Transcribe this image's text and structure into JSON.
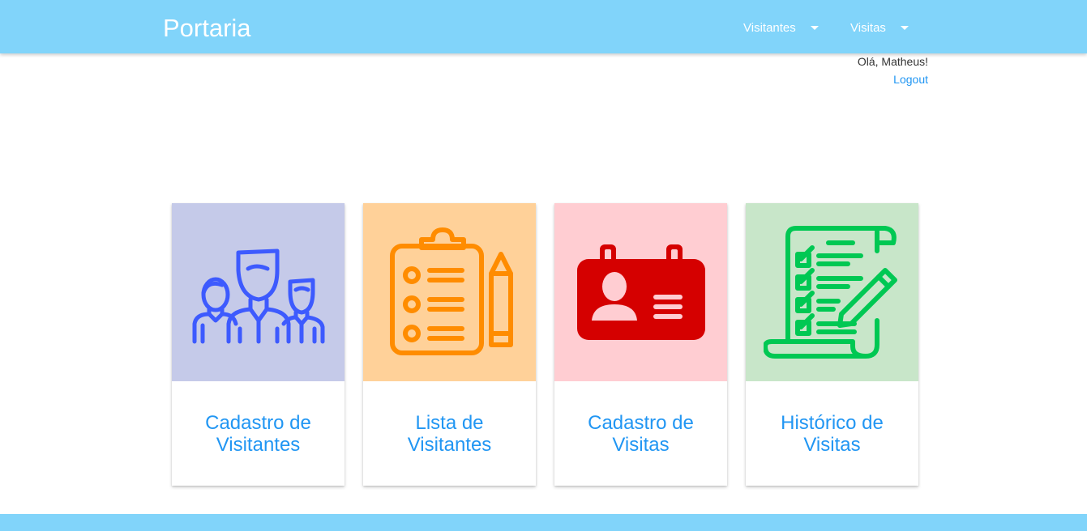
{
  "navbar": {
    "brand": "Portaria",
    "menus": [
      {
        "label": "Visitantes"
      },
      {
        "label": "Visitas"
      }
    ]
  },
  "user": {
    "greeting": "Olá, Matheus!",
    "logout": "Logout"
  },
  "cards": [
    {
      "title": "Cadastro de Visitantes",
      "icon": "people-group-icon",
      "bg": "#c5cae9",
      "color": "#3d5afe"
    },
    {
      "title": "Lista de Visitantes",
      "icon": "clipboard-list-icon",
      "bg": "#ffd199",
      "color": "#ff8c00"
    },
    {
      "title": "Cadastro de Visitas",
      "icon": "id-badge-icon",
      "bg": "#ffcdd2",
      "color": "#d50000"
    },
    {
      "title": "Histórico de Visitas",
      "icon": "checklist-scroll-icon",
      "bg": "#c8e6c9",
      "color": "#00c853"
    }
  ],
  "colors": {
    "primary": "#81d4fa",
    "link": "#2196f3"
  }
}
